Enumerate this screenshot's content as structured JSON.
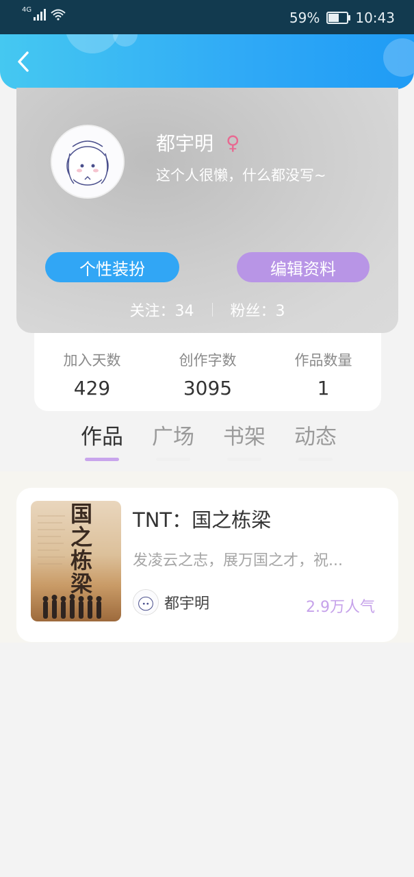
{
  "status_bar": {
    "network": "4G",
    "battery": "59%",
    "battery_level": 0.59,
    "time": "10:43"
  },
  "profile": {
    "name": "都宇明",
    "gender_symbol": "♀",
    "bio": "这个人很懒，什么都没写~",
    "btn_dress": "个性装扮",
    "btn_edit": "编辑资料",
    "following": "关注：34",
    "followers": "粉丝：3"
  },
  "stats": [
    {
      "label": "加入天数",
      "value": "429"
    },
    {
      "label": "创作字数",
      "value": "3095"
    },
    {
      "label": "作品数量",
      "value": "1"
    }
  ],
  "tabs": [
    {
      "label": "作品",
      "active": true
    },
    {
      "label": "广场",
      "active": false
    },
    {
      "label": "书架",
      "active": false
    },
    {
      "label": "动态",
      "active": false
    }
  ],
  "book": {
    "cover_text": "国之栋梁",
    "title": "TNT：国之栋梁",
    "desc": "发凌云之志，展万国之才，祝...",
    "author": "都宇明",
    "popularity": "2.9万人气"
  },
  "colors": {
    "accent_blue": "#31a6f5",
    "accent_purple": "#b895e6",
    "female": "#e86a92"
  }
}
